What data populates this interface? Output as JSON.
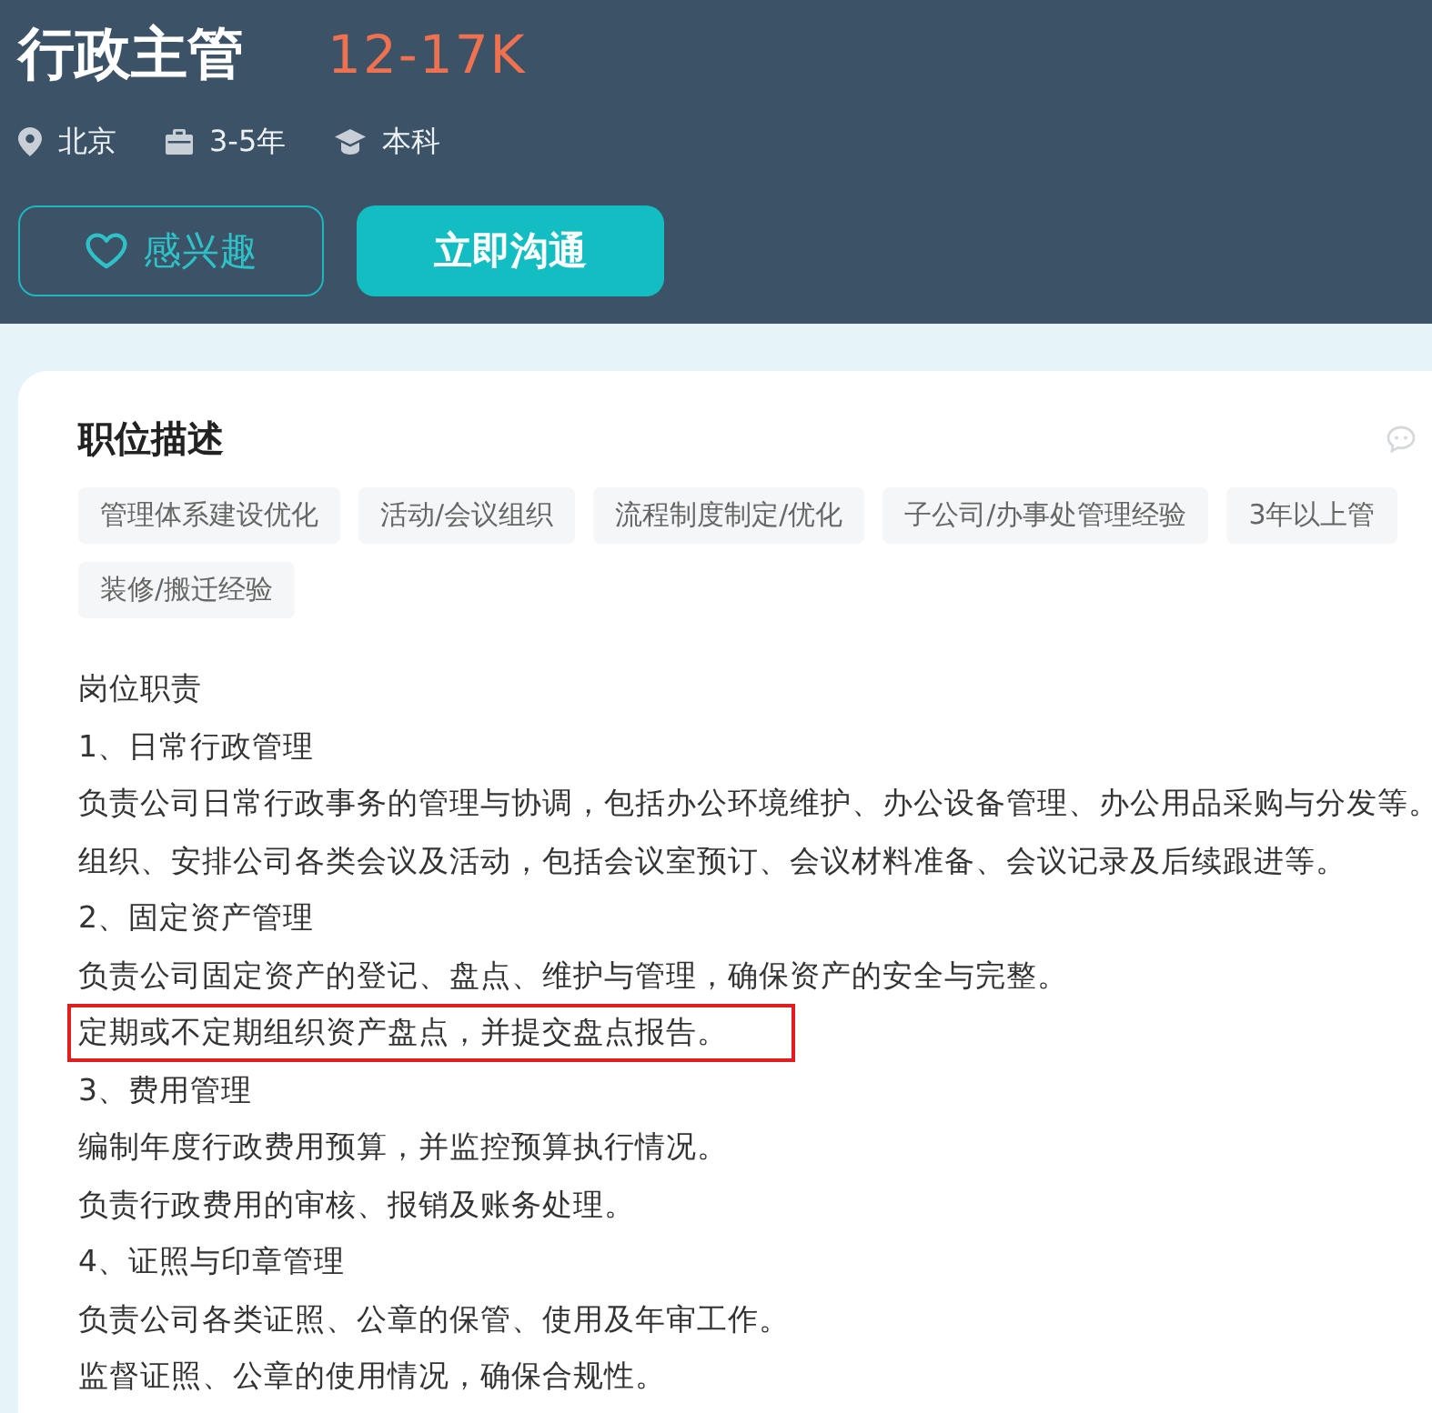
{
  "header": {
    "title": "行政主管",
    "salary": "12-17K",
    "meta": [
      {
        "kind": "location",
        "text": "北京"
      },
      {
        "kind": "experience",
        "text": "3-5年"
      },
      {
        "kind": "education",
        "text": "本科"
      }
    ],
    "buttons": [
      {
        "kind": "outline",
        "label": "感兴趣"
      },
      {
        "kind": "primary",
        "label": "立即沟通"
      }
    ]
  },
  "description": {
    "heading": "职位描述",
    "tags": [
      "管理体系建设优化",
      "活动/会议组织",
      "流程制度制定/优化",
      "子公司/办事处管理经验",
      "3年以上管",
      "装修/搬迁经验"
    ],
    "lines": [
      {
        "text": "岗位职责",
        "highlighted": false
      },
      {
        "text": "1、日常行政管理",
        "highlighted": false
      },
      {
        "text": "负责公司日常行政事务的管理与协调，包括办公环境维护、办公设备管理、办公用品采购与分发等。",
        "highlighted": false
      },
      {
        "text": "组织、安排公司各类会议及活动，包括会议室预订、会议材料准备、会议记录及后续跟进等。",
        "highlighted": false
      },
      {
        "text": "2、固定资产管理",
        "highlighted": false
      },
      {
        "text": "负责公司固定资产的登记、盘点、维护与管理，确保资产的安全与完整。",
        "highlighted": false
      },
      {
        "text": "定期或不定期组织资产盘点，并提交盘点报告。",
        "highlighted": true
      },
      {
        "text": "3、费用管理",
        "highlighted": false
      },
      {
        "text": "编制年度行政费用预算，并监控预算执行情况。",
        "highlighted": false
      },
      {
        "text": "负责行政费用的审核、报销及账务处理。",
        "highlighted": false
      },
      {
        "text": "4、证照与印章管理",
        "highlighted": false
      },
      {
        "text": "负责公司各类证照、公章的保管、使用及年审工作。",
        "highlighted": false
      },
      {
        "text": "监督证照、公章的使用情况，确保合规性。",
        "highlighted": false
      }
    ]
  }
}
